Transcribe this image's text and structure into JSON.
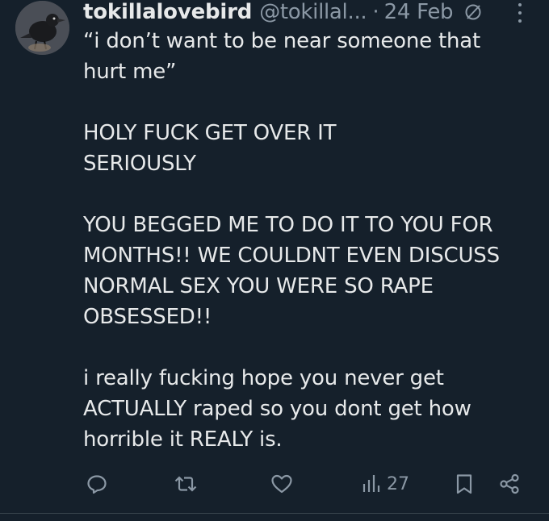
{
  "tweet": {
    "display_name": "tokillalovebird",
    "handle": "@tokillal...",
    "separator": "·",
    "date": "24 Feb",
    "paragraphs": [
      [
        "“i don’t want to be near someone that",
        "hurt me”"
      ],
      [
        "HOLY FUCK GET OVER IT",
        "SERIOUSLY"
      ],
      [
        "YOU BEGGED ME TO DO IT TO YOU FOR",
        "MONTHS!! WE COULDNT EVEN DISCUSS",
        "NORMAL SEX YOU WERE SO RAPE",
        "OBSESSED!!"
      ],
      [
        "i really fucking hope you never get",
        "ACTUALLY raped so you dont get how",
        "horrible it REALY is."
      ]
    ],
    "actions": {
      "reply_icon": "reply-icon",
      "retweet_icon": "retweet-icon",
      "like_icon": "heart-icon",
      "views_icon": "views-icon",
      "views_count": "27",
      "bookmark_icon": "bookmark-icon",
      "share_icon": "share-icon"
    }
  },
  "colors": {
    "background": "#15202b",
    "text_primary": "#e7e9ea",
    "text_secondary": "#8b98a5"
  }
}
